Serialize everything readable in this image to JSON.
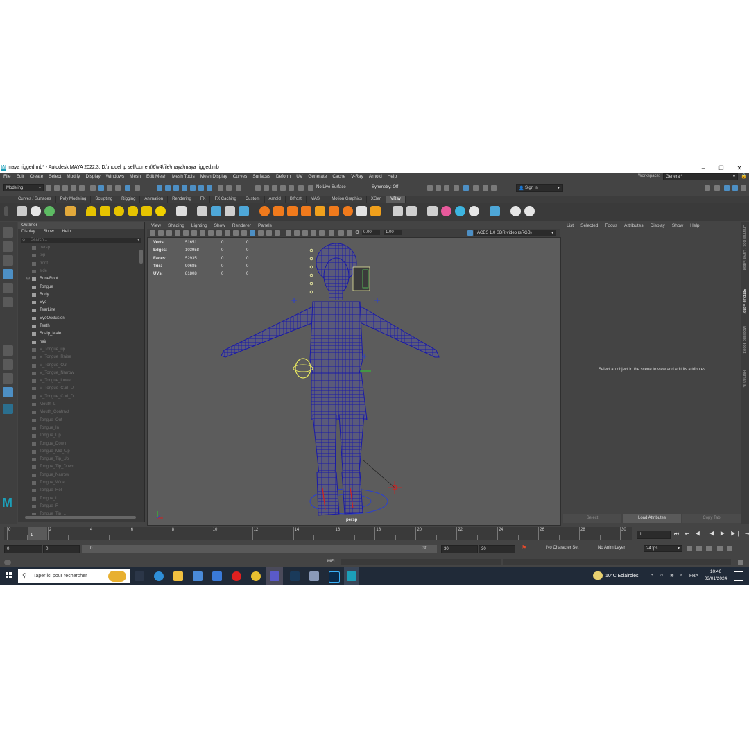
{
  "window": {
    "title": "maya rigged.mb* - Autodesk MAYA 2022.3: D:\\model tp sell\\current\\6\\v4\\file\\maya\\maya rigged.mb",
    "logo": "M"
  },
  "menubar": {
    "items": [
      "File",
      "Edit",
      "Create",
      "Select",
      "Modify",
      "Display",
      "Windows",
      "Mesh",
      "Edit Mesh",
      "Mesh Tools",
      "Mesh Display",
      "Curves",
      "Surfaces",
      "Deform",
      "UV",
      "Generate",
      "Cache",
      "V-Ray",
      "Arnold",
      "Help"
    ],
    "workspace_label": "Workspace:",
    "workspace_value": "General*"
  },
  "statusline": {
    "mode": "Modeling",
    "live_surface": "No Live Surface",
    "symmetry": "Symmetry: Off",
    "sign_in": "Sign In"
  },
  "shelf": {
    "tabs": [
      "Curves / Surfaces",
      "Poly Modeling",
      "Sculpting",
      "Rigging",
      "Animation",
      "Rendering",
      "FX",
      "FX Caching",
      "Custom",
      "Arnold",
      "Bifrost",
      "MASH",
      "Motion Graphics",
      "XGen",
      "VRay"
    ],
    "active_tab": "VRay"
  },
  "outliner": {
    "title": "Outliner",
    "menu": [
      "Display",
      "Show",
      "Help"
    ],
    "search_placeholder": "Search...",
    "items": [
      {
        "label": "persp",
        "dim": true
      },
      {
        "label": "top",
        "dim": true
      },
      {
        "label": "front",
        "dim": true
      },
      {
        "label": "side",
        "dim": true
      },
      {
        "label": "BoneRoot",
        "dim": false
      },
      {
        "label": "Tongue",
        "dim": false
      },
      {
        "label": "Body",
        "dim": false
      },
      {
        "label": "Eye",
        "dim": false
      },
      {
        "label": "TearLine",
        "dim": false
      },
      {
        "label": "EyeOcclusion",
        "dim": false
      },
      {
        "label": "Teeth",
        "dim": false
      },
      {
        "label": "Scalp_Male",
        "dim": false
      },
      {
        "label": "hair",
        "dim": false
      },
      {
        "label": "V_Tongue_up",
        "dim": true
      },
      {
        "label": "V_Tongue_Raise",
        "dim": true
      },
      {
        "label": "V_Tongue_Out",
        "dim": true
      },
      {
        "label": "V_Tongue_Narrow",
        "dim": true
      },
      {
        "label": "V_Tongue_Lower",
        "dim": true
      },
      {
        "label": "V_Tongue_Curl_U",
        "dim": true
      },
      {
        "label": "V_Tongue_Curl_D",
        "dim": true
      },
      {
        "label": "Mouth_L",
        "dim": true
      },
      {
        "label": "Mouth_Contract",
        "dim": true
      },
      {
        "label": "Tongue_Out",
        "dim": true
      },
      {
        "label": "Tongue_In",
        "dim": true
      },
      {
        "label": "Tongue_Up",
        "dim": true
      },
      {
        "label": "Tongue_Down",
        "dim": true
      },
      {
        "label": "Tongue_Mid_Up",
        "dim": true
      },
      {
        "label": "Tongue_Tip_Up",
        "dim": true
      },
      {
        "label": "Tongue_Tip_Down",
        "dim": true
      },
      {
        "label": "Tongue_Narrow",
        "dim": true
      },
      {
        "label": "Tongue_Wide",
        "dim": true
      },
      {
        "label": "Tongue_Roll",
        "dim": true
      },
      {
        "label": "Tongue_L",
        "dim": true
      },
      {
        "label": "Tongue_R",
        "dim": true
      },
      {
        "label": "Tongue_Tip_L",
        "dim": true
      }
    ]
  },
  "viewport": {
    "menu": [
      "View",
      "Shading",
      "Lighting",
      "Show",
      "Renderer",
      "Panels"
    ],
    "exposure": "0.00",
    "gamma": "1.00",
    "color_space": "ACES 1.0 SDR-video (sRGB)",
    "camera_label": "persp",
    "hud": [
      {
        "label": "Verts:",
        "v1": "51651",
        "v2": "0",
        "v3": "0"
      },
      {
        "label": "Edges:",
        "v1": "103958",
        "v2": "0",
        "v3": "0"
      },
      {
        "label": "Faces:",
        "v1": "52935",
        "v2": "0",
        "v3": "0"
      },
      {
        "label": "Tris:",
        "v1": "90685",
        "v2": "0",
        "v3": "0"
      },
      {
        "label": "UVs:",
        "v1": "81808",
        "v2": "0",
        "v3": "0"
      }
    ],
    "mesh_color": "#1a1aa8"
  },
  "attribute_editor": {
    "menu": [
      "List",
      "Selected",
      "Focus",
      "Attributes",
      "Display",
      "Show",
      "Help"
    ],
    "message": "Select an object in the scene to view and edit its attributes",
    "buttons": [
      "Select",
      "Load Attributes",
      "Copy Tab"
    ]
  },
  "side_tabs": [
    "Channel Box / Layer Editor",
    "Attribute Editor",
    "Modeling Toolkit",
    "Human IK"
  ],
  "timeslider": {
    "ticks": [
      "0",
      "2",
      "4",
      "6",
      "8",
      "10",
      "12",
      "14",
      "16",
      "18",
      "20",
      "22",
      "24",
      "26",
      "28",
      "30"
    ],
    "current_frame": "1",
    "current_frame_field": "1"
  },
  "range": {
    "start": "0",
    "playback_start": "0",
    "slider_start": "0",
    "slider_end": "30",
    "playback_end": "30",
    "end": "30",
    "character_set": "No Character Set",
    "anim_layer": "No Anim Layer",
    "fps": "24 fps"
  },
  "cmdline": {
    "language": "MEL"
  },
  "taskbar": {
    "search_placeholder": "Taper ici pour rechercher",
    "weather": "10°C  Eclaircies",
    "language": "FRA",
    "time": "10:46",
    "date": "03/01/2024"
  }
}
